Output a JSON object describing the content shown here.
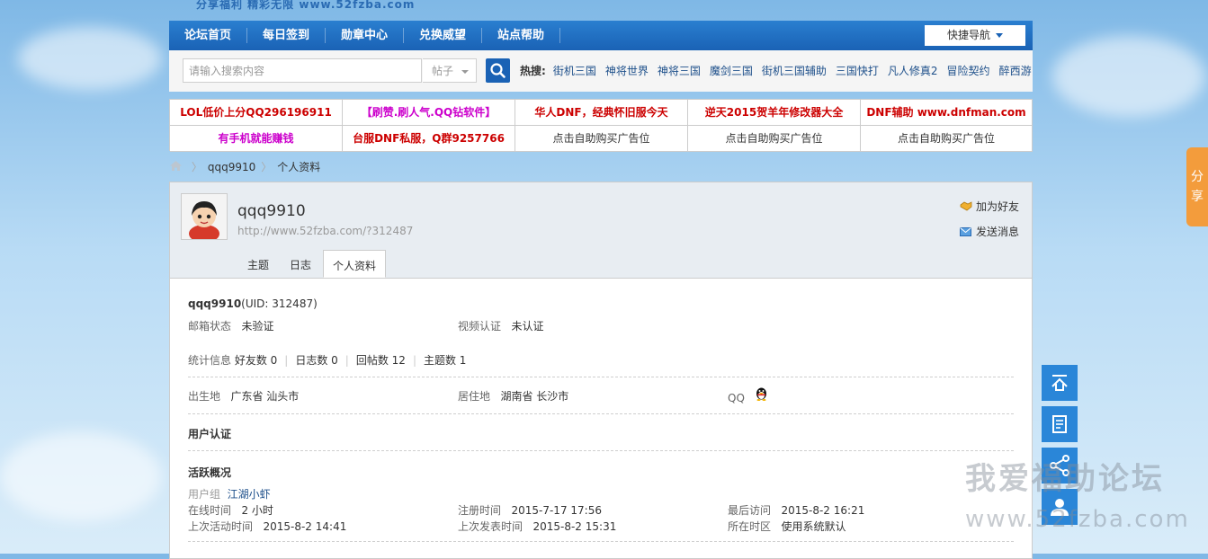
{
  "site_logo_text": "分享福利 精彩无限 www.52fzba.com",
  "nav": {
    "items": [
      "论坛首页",
      "每日签到",
      "勋章中心",
      "兑换威望",
      "站点帮助"
    ],
    "quick_nav": "快捷导航"
  },
  "search": {
    "placeholder": "请输入搜索内容",
    "type": "帖子",
    "hot_label": "热搜:",
    "hot_keywords": [
      "街机三国",
      "神将世界",
      "神将三国",
      "魔剑三国",
      "街机三国辅助",
      "三国快打",
      "凡人修真2",
      "冒险契约",
      "醉西游"
    ]
  },
  "ads": [
    {
      "text": "LOL低价上分QQ296196911",
      "color": "#cc0000"
    },
    {
      "text": "【刷赞.刷人气.QQ钻软件】",
      "color": "#cc00cc"
    },
    {
      "text": "华人DNF，经典怀旧服今天",
      "color": "#cc0000"
    },
    {
      "text": "逆天2015贺羊年修改器大全",
      "color": "#cc0000"
    },
    {
      "text": "DNF辅助 www.dnfman.com",
      "color": "#cc0000"
    },
    {
      "text": "有手机就能赚钱",
      "color": "#cc00cc"
    },
    {
      "text": "台服DNF私服，Q群9257766",
      "color": "#cc0000"
    },
    {
      "text": "点击自助购买广告位",
      "color": "#333333"
    },
    {
      "text": "点击自助购买广告位",
      "color": "#333333"
    },
    {
      "text": "点击自助购买广告位",
      "color": "#333333"
    }
  ],
  "breadcrumb": [
    "qqq9910",
    "个人资料"
  ],
  "profile": {
    "username": "qqq9910",
    "url": "http://www.52fzba.com/?312487",
    "add_friend": "加为好友",
    "send_message": "发送消息",
    "tabs": [
      "主题",
      "日志",
      "个人资料"
    ],
    "active_tab": "个人资料",
    "uid_text": "(UID: 312487)",
    "email_status_label": "邮箱状态",
    "email_status": "未验证",
    "video_auth_label": "视频认证",
    "video_auth": "未认证",
    "stats_label": "统计信息",
    "friends": "好友数 0",
    "blogs": "日志数 0",
    "replies": "回帖数 12",
    "threads": "主题数 1",
    "birthplace_label": "出生地",
    "birthplace": "广东省 汕头市",
    "residence_label": "居住地",
    "residence": "湖南省 长沙市",
    "qq_label": "QQ",
    "user_auth_title": "用户认证",
    "activity_title": "活跃概况",
    "group_label": "用户组",
    "group": "江湖小虾",
    "online_label": "在线时间",
    "online": "2 小时",
    "reg_label": "注册时间",
    "reg": "2015-7-17 17:56",
    "last_visit_label": "最后访问",
    "last_visit": "2015-8-2 16:21",
    "last_active_label": "上次活动时间",
    "last_active": "2015-8-2 14:41",
    "last_post_label": "上次发表时间",
    "last_post": "2015-8-2 15:31",
    "timezone_label": "所在时区",
    "timezone": "使用系统默认"
  },
  "share_label": "分享",
  "watermark": {
    "line1": "我爱福助论坛",
    "line2": "www.52fzba.com"
  }
}
